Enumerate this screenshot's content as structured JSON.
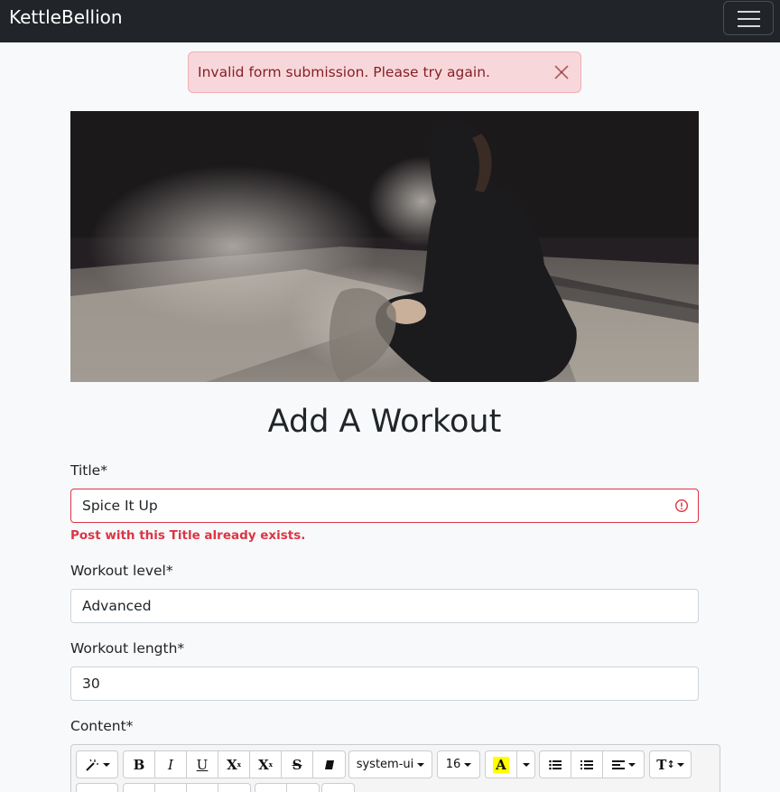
{
  "navbar": {
    "brand": "KettleBellion"
  },
  "alert": {
    "message": "Invalid form submission. Please try again."
  },
  "page": {
    "title": "Add A Workout"
  },
  "form": {
    "title": {
      "label": "Title*",
      "value": "Spice It Up",
      "error": "Post with this Title already exists."
    },
    "level": {
      "label": "Workout level*",
      "value": "Advanced"
    },
    "length": {
      "label": "Workout length*",
      "value": "30"
    },
    "content": {
      "label": "Content*"
    }
  },
  "editor": {
    "toolbar": {
      "bold": "B",
      "italic": "I",
      "underline": "U",
      "superscript": "X",
      "subscript": "X",
      "strikethrough": "S",
      "font_family": "system-ui",
      "font_size": "16",
      "highlight": "A",
      "text_style": "T"
    },
    "icons": [
      "magic-icon",
      "eraser-icon",
      "unordered-list-icon",
      "ordered-list-icon",
      "align-icon",
      "line-height-icon"
    ],
    "colors": {
      "highlight": "#ffff00"
    }
  },
  "colors": {
    "navbar": "#212529",
    "alert_bg": "#f8d7da",
    "alert_text": "#842029",
    "danger": "#dc3545",
    "page_bg": "#f8f9fa"
  }
}
